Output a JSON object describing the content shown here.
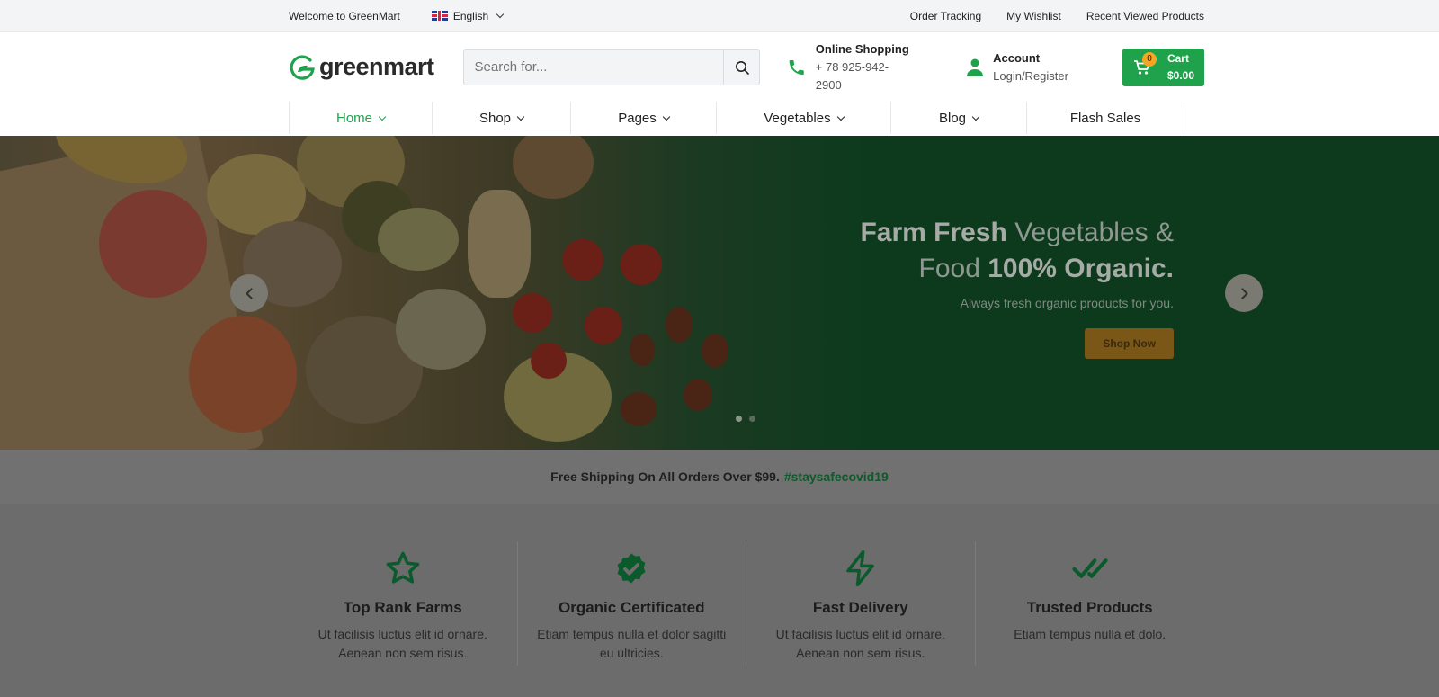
{
  "topbar": {
    "welcome": "Welcome to GreenMart",
    "language": "English",
    "links": [
      "Order Tracking",
      "My Wishlist",
      "Recent Viewed Products"
    ]
  },
  "header": {
    "logo_text": "greenmart",
    "search_placeholder": "Search for...",
    "phone_title": "Online Shopping",
    "phone_number": "+ 78 925-942-2900",
    "account_title": "Account",
    "account_sub": "Login/Register",
    "cart_label": "Cart",
    "cart_total": "$0.00",
    "cart_count": "0"
  },
  "nav": {
    "items": [
      {
        "label": "Home",
        "dropdown": true,
        "active": true
      },
      {
        "label": "Shop",
        "dropdown": true
      },
      {
        "label": "Pages",
        "dropdown": true
      },
      {
        "label": "Vegetables",
        "dropdown": true
      },
      {
        "label": "Blog",
        "dropdown": true
      },
      {
        "label": "Flash Sales",
        "dropdown": false
      }
    ]
  },
  "hero": {
    "title_bold_1": "Farm Fresh",
    "title_light_1": "Vegetables &",
    "title_light_2": "Food",
    "title_bold_2": "100% Organic.",
    "subtitle": "Always fresh organic products for you.",
    "cta": "Shop Now",
    "slides": 2
  },
  "shipping": {
    "text": "Free Shipping On All Orders Over $99.",
    "tag": "#staysafecovid19"
  },
  "features": [
    {
      "icon": "star-icon",
      "title": "Top Rank Farms",
      "text": "Ut facilisis luctus elit id ornare. Aenean non sem risus."
    },
    {
      "icon": "badge-check-icon",
      "title": "Organic Certificated",
      "text": "Etiam tempus nulla et dolor sagitti eu ultricies."
    },
    {
      "icon": "lightning-icon",
      "title": "Fast Delivery",
      "text": "Ut facilisis luctus elit id ornare. Aenean non sem risus."
    },
    {
      "icon": "double-check-icon",
      "title": "Trusted Products",
      "text": "Etiam tempus nulla et dolo."
    }
  ],
  "colors": {
    "brand": "#1fa24b",
    "accent": "#f5a623"
  }
}
